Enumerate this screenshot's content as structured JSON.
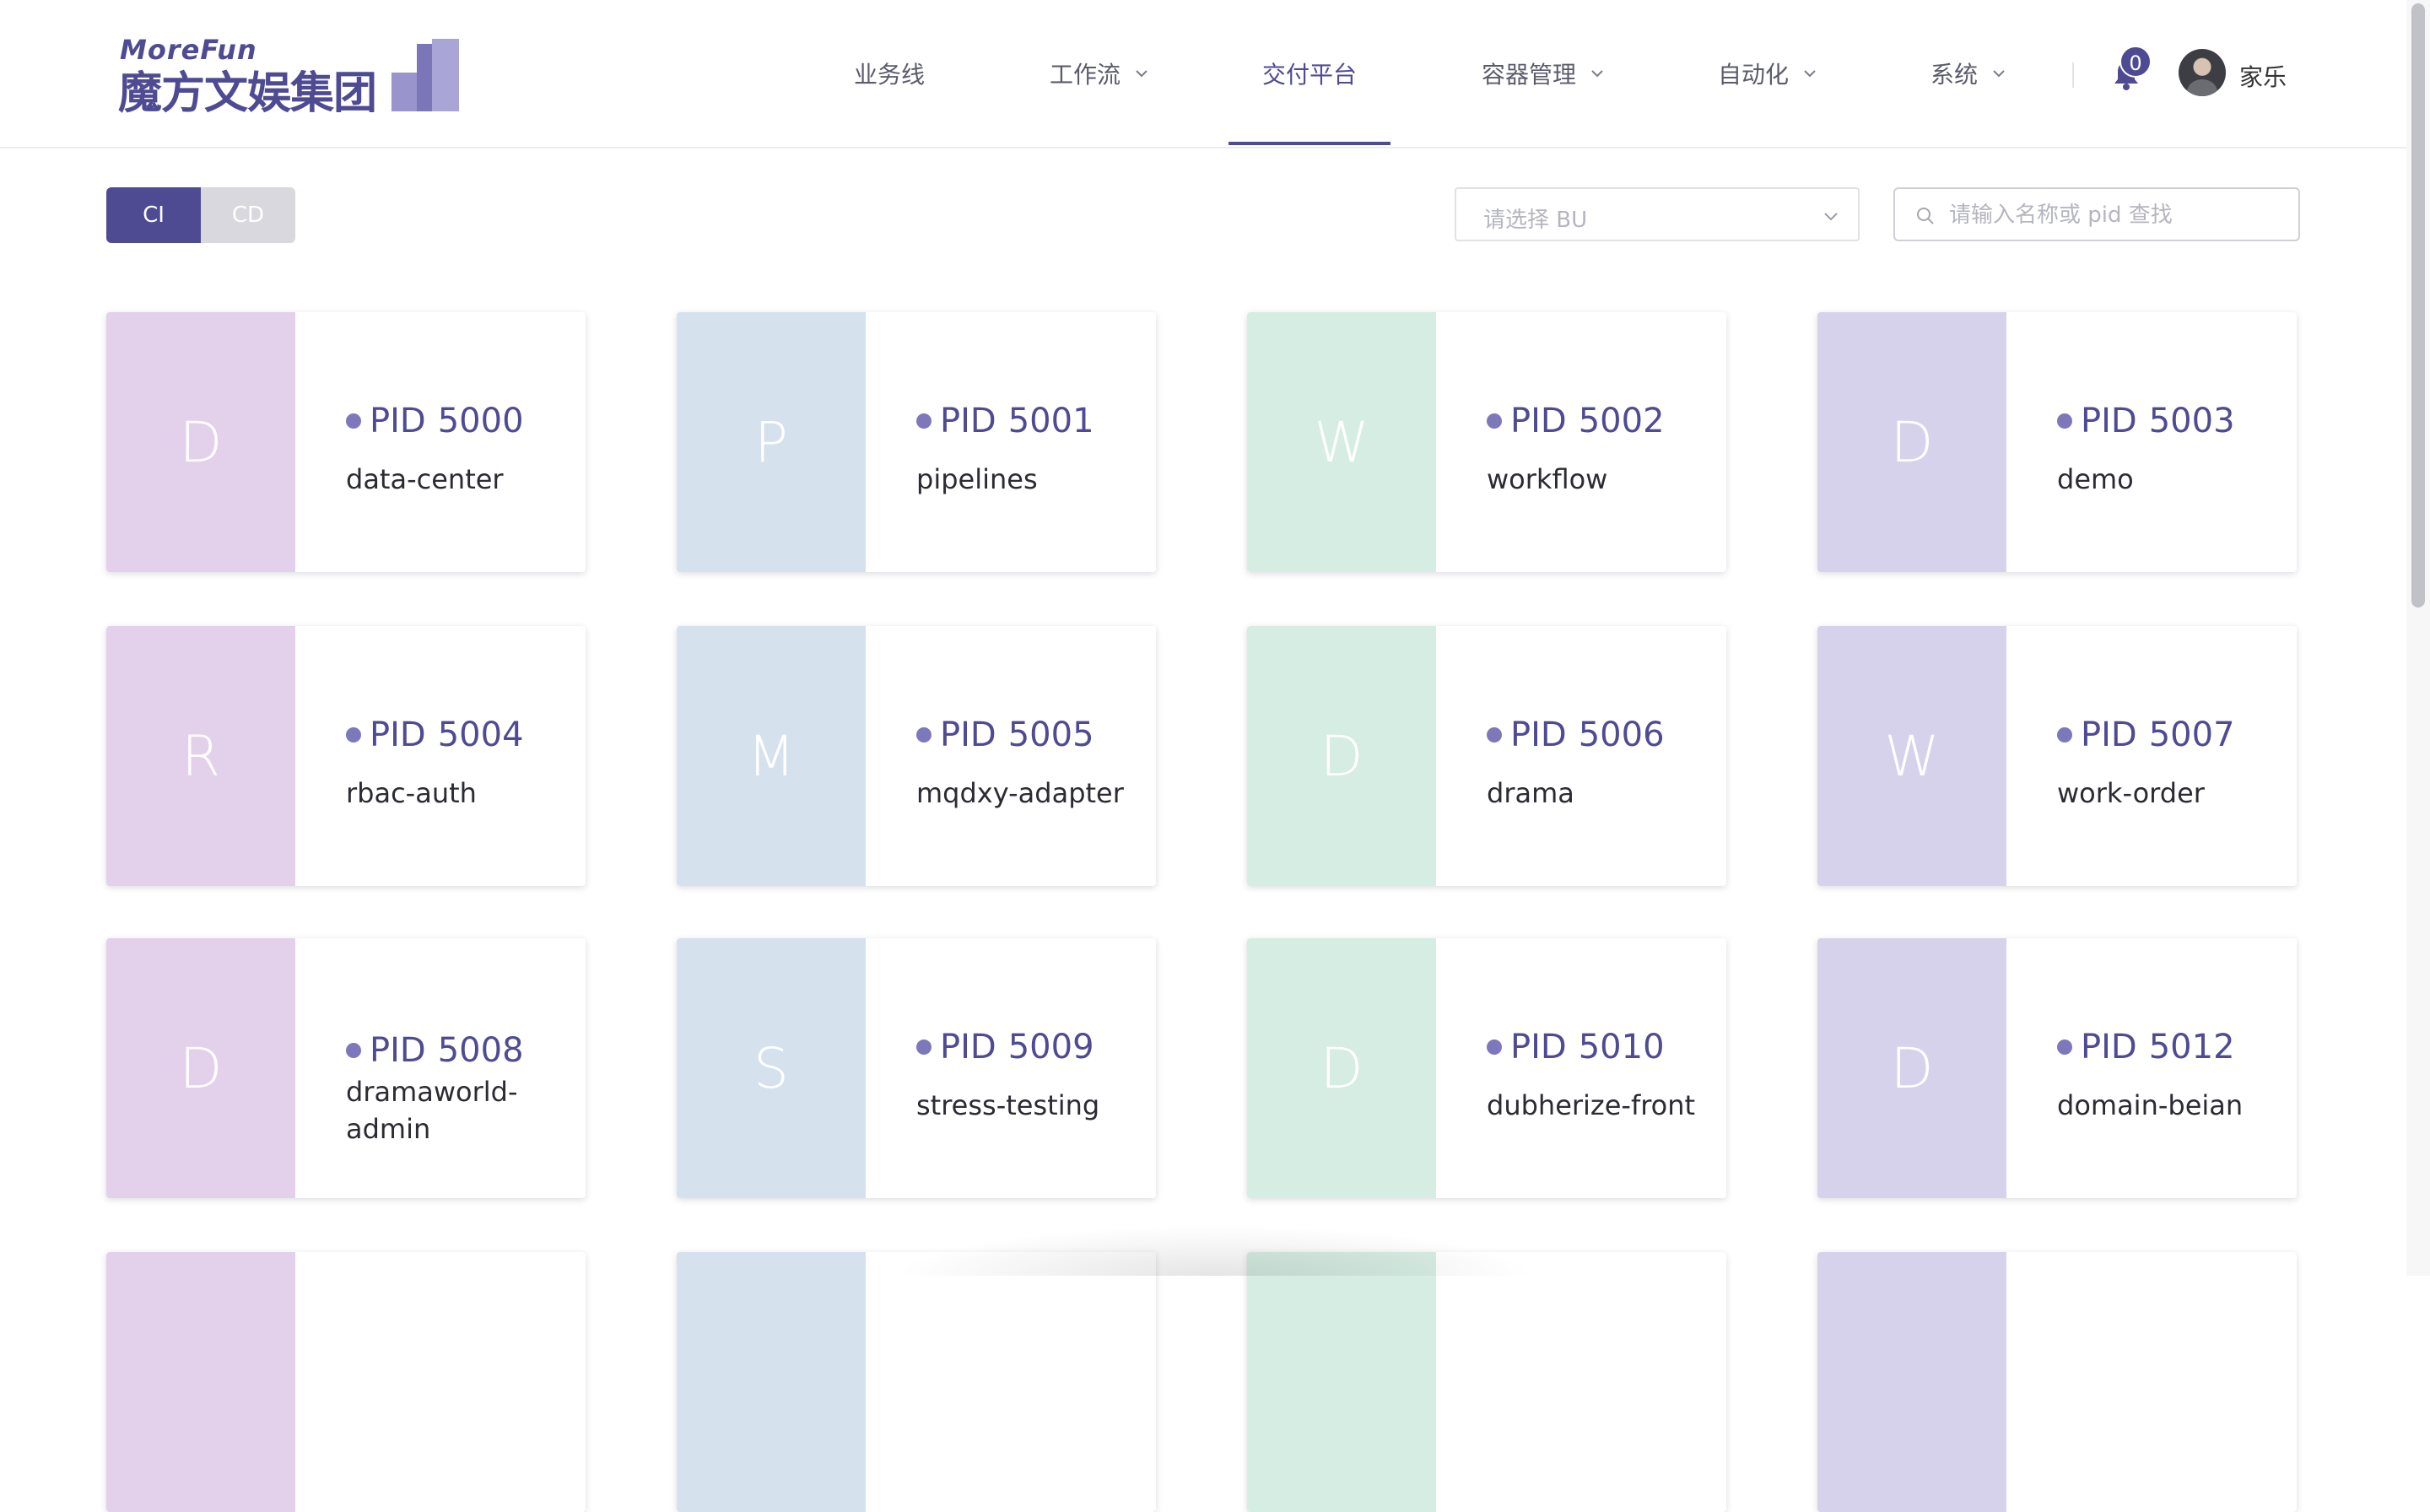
{
  "brand": {
    "logo_en": "MoreFun",
    "logo_cn": "魔方文娱集团",
    "accent": "#4e4b93"
  },
  "nav": {
    "items": [
      {
        "label": "业务线",
        "dropdown": false,
        "active": false
      },
      {
        "label": "工作流",
        "dropdown": true,
        "active": false
      },
      {
        "label": "交付平台",
        "dropdown": false,
        "active": true
      },
      {
        "label": "容器管理",
        "dropdown": true,
        "active": false
      },
      {
        "label": "自动化",
        "dropdown": true,
        "active": false
      },
      {
        "label": "系统",
        "dropdown": true,
        "active": false
      }
    ],
    "notifications": "0",
    "username": "家乐"
  },
  "toolbar": {
    "tabs": [
      {
        "label": "CI",
        "selected": true
      },
      {
        "label": "CD",
        "selected": false
      }
    ],
    "bu_select_placeholder": "请选择 BU",
    "search_placeholder": "请输入名称或 pid 查找"
  },
  "tile_colors": [
    "#e3d1eb",
    "#d5e2ee",
    "#d6ede3",
    "#d6d2ec"
  ],
  "pid_prefix": "PID",
  "projects": [
    {
      "letter": "D",
      "pid": "5000",
      "name": "data-center"
    },
    {
      "letter": "P",
      "pid": "5001",
      "name": "pipelines"
    },
    {
      "letter": "W",
      "pid": "5002",
      "name": "workflow"
    },
    {
      "letter": "D",
      "pid": "5003",
      "name": "demo"
    },
    {
      "letter": "R",
      "pid": "5004",
      "name": "rbac-auth"
    },
    {
      "letter": "M",
      "pid": "5005",
      "name": "mqdxy-adapter"
    },
    {
      "letter": "D",
      "pid": "5006",
      "name": "drama"
    },
    {
      "letter": "W",
      "pid": "5007",
      "name": "work-order"
    },
    {
      "letter": "D",
      "pid": "5008",
      "name": "dramaworld-admin"
    },
    {
      "letter": "S",
      "pid": "5009",
      "name": "stress-testing"
    },
    {
      "letter": "D",
      "pid": "5010",
      "name": "dubherize-front"
    },
    {
      "letter": "D",
      "pid": "5012",
      "name": "domain-beian"
    }
  ]
}
